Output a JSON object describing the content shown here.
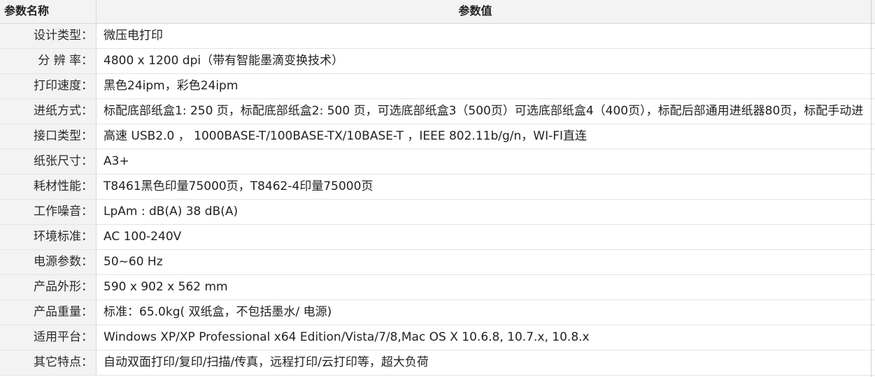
{
  "header": {
    "name_label": "参数名称",
    "value_label": "参数值"
  },
  "rows": [
    {
      "name": "设计类型：",
      "value": "微压电打印"
    },
    {
      "name": "分 辨 率：",
      "value": "4800 x 1200 dpi（带有智能墨滴变换技术）"
    },
    {
      "name": "打印速度：",
      "value": "黑色24ipm，彩色24ipm"
    },
    {
      "name": "进纸方式：",
      "value": "标配底部纸盒1: 250 页，标配底部纸盒2: 500 页，可选底部纸盒3（500页）可选底部纸盒4（400页），标配后部通用进纸器80页，标配手动进"
    },
    {
      "name": "接口类型：",
      "value": "高速 USB2.0 ， 1000BASE-T/100BASE-TX/10BASE-T ，IEEE 802.11b/g/n，WI-FI直连"
    },
    {
      "name": "纸张尺寸：",
      "value": "A3+"
    },
    {
      "name": "耗材性能：",
      "value": "T8461黑色印量75000页，T8462-4印量75000页"
    },
    {
      "name": "工作噪音：",
      "value": "LpAm : dB(A) 38 dB(A)"
    },
    {
      "name": "环境标准：",
      "value": "AC 100-240V"
    },
    {
      "name": "电源参数：",
      "value": "50~60 Hz"
    },
    {
      "name": "产品外形：",
      "value": "590 x 902 x 562 mm"
    },
    {
      "name": "产品重量：",
      "value": "标准：65.0kg( 双纸盒，不包括墨水/ 电源)"
    },
    {
      "name": "适用平台：",
      "value": "Windows XP/XP Professional x64 Edition/Vista/7/8,Mac OS X 10.6.8, 10.7.x, 10.8.x"
    },
    {
      "name": "其它特点：",
      "value": "自动双面打印/复印/扫描/传真，远程打印/云打印等，超大负荷"
    }
  ]
}
